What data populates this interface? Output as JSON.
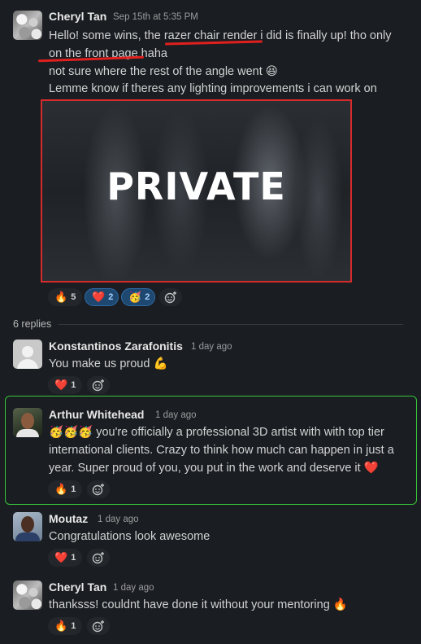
{
  "root_message": {
    "author": "Cheryl Tan",
    "timestamp": "Sep 15th at 5:35 PM",
    "line1_a": "Hello! some wins, the ",
    "line1_b": "razer chair render",
    "line1_c": " i did is finally up! tho only",
    "line2_a": "on the front page",
    "line2_b": " haha",
    "line3": "not sure where the rest of the angle went 😆",
    "line4": "Lemme know if theres any lighting improvements i can work on",
    "image_overlay": "PRIVATE",
    "reactions": [
      {
        "emoji": "🔥",
        "count": "5",
        "active": false
      },
      {
        "emoji": "❤️",
        "count": "2",
        "active": true
      },
      {
        "emoji": "🥳",
        "count": "2",
        "active": true
      }
    ]
  },
  "thread": {
    "replies_label": "6 replies"
  },
  "replies": [
    {
      "author": "Konstantinos Zarafonitis",
      "timestamp": "1 day ago",
      "text": "You make us proud 💪",
      "reaction": {
        "emoji": "❤️",
        "count": "1"
      }
    },
    {
      "author": "Arthur Whitehead",
      "timestamp": "1 day ago",
      "line1": "🥳🥳🥳 you're officially a professional 3D artist with with top tier",
      "line2": "international clients. Crazy to think how much can happen in just a",
      "line3": "year. Super proud of you, you put in the work and deserve it ❤️",
      "reaction": {
        "emoji": "🔥",
        "count": "1"
      }
    },
    {
      "author": "Moutaz",
      "timestamp": "1 day ago",
      "text": "Congratulations look awesome",
      "reaction": {
        "emoji": "❤️",
        "count": "1"
      }
    },
    {
      "author": "Cheryl Tan",
      "timestamp": "1 day ago",
      "text": "thanksss! couldnt have done it without your mentoring 🔥",
      "reaction": {
        "emoji": "🔥",
        "count": "1"
      }
    }
  ],
  "icons": {
    "add_reaction": "add-reaction-icon"
  },
  "colors": {
    "background": "#1a1d21",
    "annotation_red": "#e0201f",
    "highlight_green": "#36c83a",
    "active_reaction": "#1f4870"
  }
}
